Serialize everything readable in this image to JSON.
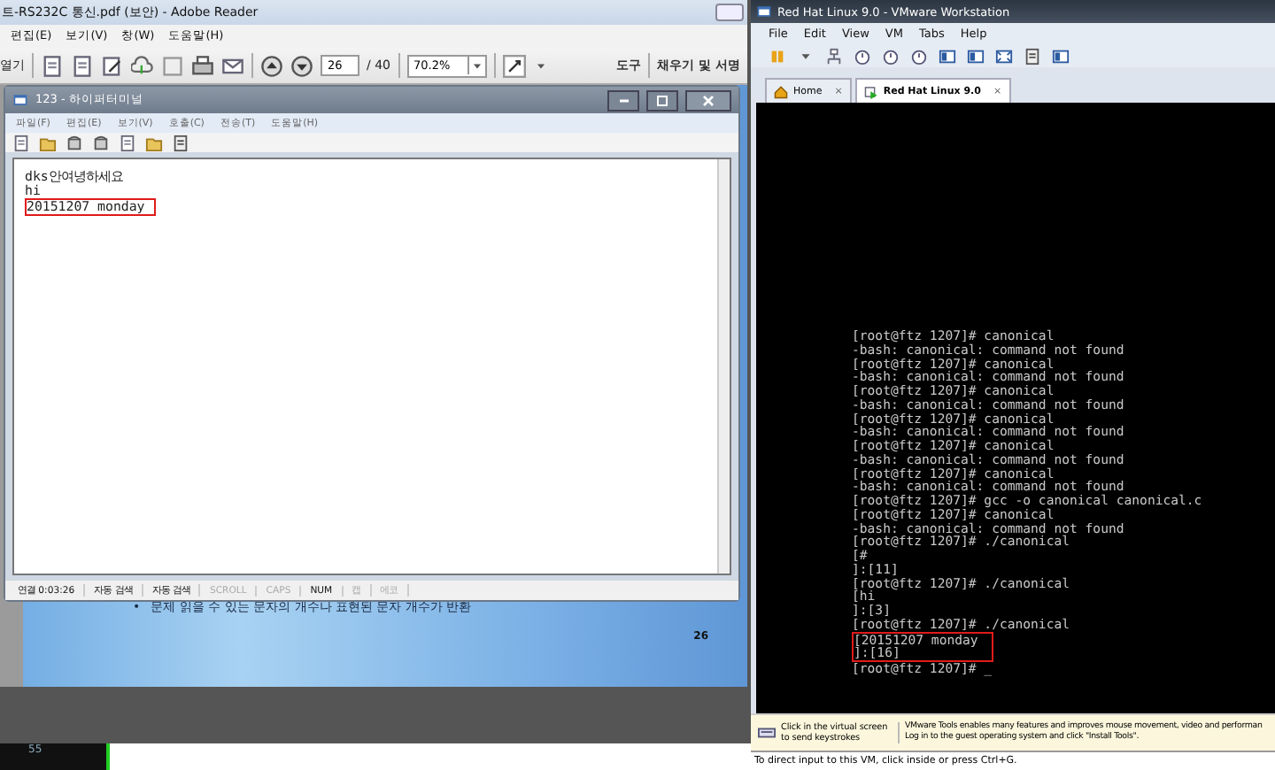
{
  "reader": {
    "title": "트-RS232C 통신.pdf (보안) - Adobe Reader",
    "menu": [
      "편집(E)",
      "보기(V)",
      "창(W)",
      "도움말(H)"
    ],
    "toolbar": {
      "open_label": "열기",
      "page": "26",
      "page_total": "/ 40",
      "zoom": "70.2%",
      "tools": "도구",
      "sign": "채우기 및 서명"
    },
    "slide": {
      "bullet": "•",
      "text": "문제 읽을 수 있는 문자의 개수나 표현된 문자 개수가 반환",
      "page_number": "26"
    }
  },
  "terminal_window": {
    "title": "123 - 하이퍼터미널",
    "menu": [
      "파일(F)",
      "편집(E)",
      "보기(V)",
      "호출(C)",
      "전송(T)",
      "도움말(H)"
    ],
    "lines": [
      {
        "text": "dks안여녕하세요",
        "highlighted": false
      },
      {
        "text": "hi",
        "highlighted": false
      },
      {
        "text": "20151207 monday",
        "highlighted": true
      }
    ],
    "status": [
      {
        "text": "연결 0:03:26",
        "on": true
      },
      {
        "text": "자동 검색",
        "on": true
      },
      {
        "text": "자동 검색",
        "on": true
      },
      {
        "text": "SCROLL",
        "on": false
      },
      {
        "text": "CAPS",
        "on": false
      },
      {
        "text": "NUM",
        "on": true
      },
      {
        "text": "캡",
        "on": false
      },
      {
        "text": "에코",
        "on": false
      }
    ]
  },
  "taskbar": {
    "label": "55"
  },
  "vmware": {
    "title": "Red Hat Linux 9.0 - VMware Workstation",
    "menu": [
      "File",
      "Edit",
      "View",
      "VM",
      "Tabs",
      "Help"
    ],
    "tabs": [
      {
        "label": "Home",
        "close": "×",
        "selected": false
      },
      {
        "label": "Red Hat Linux 9.0",
        "close": "×",
        "selected": true
      }
    ],
    "console": [
      {
        "text": "[root@ftz 1207]# canonical",
        "highlighted": false
      },
      {
        "text": "-bash: canonical: command not found",
        "highlighted": false
      },
      {
        "text": "[root@ftz 1207]# canonical",
        "highlighted": false
      },
      {
        "text": "-bash: canonical: command not found",
        "highlighted": false
      },
      {
        "text": "[root@ftz 1207]# canonical",
        "highlighted": false
      },
      {
        "text": "-bash: canonical: command not found",
        "highlighted": false
      },
      {
        "text": "[root@ftz 1207]# canonical",
        "highlighted": false
      },
      {
        "text": "-bash: canonical: command not found",
        "highlighted": false
      },
      {
        "text": "[root@ftz 1207]# canonical",
        "highlighted": false
      },
      {
        "text": "-bash: canonical: command not found",
        "highlighted": false
      },
      {
        "text": "[root@ftz 1207]# canonical",
        "highlighted": false
      },
      {
        "text": "-bash: canonical: command not found",
        "highlighted": false
      },
      {
        "text": "[root@ftz 1207]# gcc -o canonical canonical.c",
        "highlighted": false
      },
      {
        "text": "[root@ftz 1207]# canonical",
        "highlighted": false
      },
      {
        "text": "-bash: canonical: command not found",
        "highlighted": false
      },
      {
        "text": "[root@ftz 1207]# ./canonical",
        "highlighted": false
      },
      {
        "text": "[#",
        "highlighted": false
      },
      {
        "text": "]:[11]",
        "highlighted": false
      },
      {
        "text": "[root@ftz 1207]# ./canonical",
        "highlighted": false
      },
      {
        "text": "[hi",
        "highlighted": false
      },
      {
        "text": "]:[3]",
        "highlighted": false
      },
      {
        "text": "[root@ftz 1207]# ./canonical",
        "highlighted": false
      },
      {
        "text": "[20151207 monday",
        "highlighted": true
      },
      {
        "text": "]:[16]",
        "highlighted": true
      },
      {
        "text": "[root@ftz 1207]# _",
        "highlighted": false
      }
    ],
    "hint": {
      "left": "Click in the virtual screen to send keystrokes",
      "right": [
        "VMware Tools enables many features and improves mouse movement, video and performan",
        "Log in to the guest operating system and click \"Install Tools\"."
      ]
    },
    "status": "To direct input to this VM, click inside or press Ctrl+G."
  }
}
